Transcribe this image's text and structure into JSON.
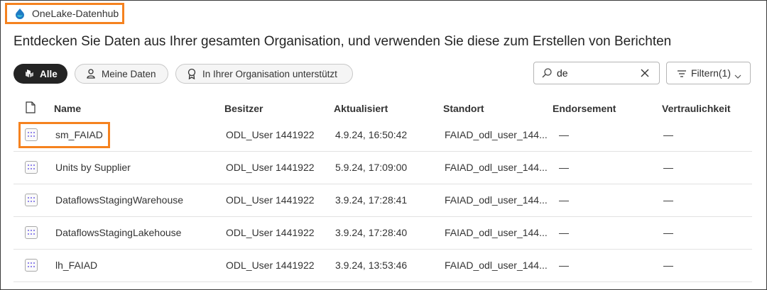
{
  "breadcrumb": {
    "label": "OneLake-Datenhub",
    "icon": "onelake-icon"
  },
  "headline": "Entdecken Sie Daten aus Ihrer gesamten Organisation, und verwenden Sie diese zum Erstellen von Berichten",
  "filters": {
    "all": "Alle",
    "mine": "Meine Daten",
    "endorsed": "In Ihrer Organisation unterstützt"
  },
  "search": {
    "value": "de"
  },
  "filter_button": {
    "label": "Filtern(1)"
  },
  "columns": {
    "name": "Name",
    "owner": "Besitzer",
    "updated": "Aktualisiert",
    "location": "Standort",
    "endorsement": "Endorsement",
    "sensitivity": "Vertraulichkeit"
  },
  "rows": [
    {
      "name": "sm_FAIAD",
      "owner": "ODL_User 1441922",
      "updated": "4.9.24, 16:50:42",
      "location": "FAIAD_odl_user_144...",
      "endorsement": "—",
      "sensitivity": "—"
    },
    {
      "name": "Units by Supplier",
      "owner": "ODL_User 1441922",
      "updated": "5.9.24, 17:09:00",
      "location": "FAIAD_odl_user_144...",
      "endorsement": "—",
      "sensitivity": "—"
    },
    {
      "name": "DataflowsStagingWarehouse",
      "owner": "ODL_User 1441922",
      "updated": "3.9.24, 17:28:41",
      "location": "FAIAD_odl_user_144...",
      "endorsement": "—",
      "sensitivity": "—"
    },
    {
      "name": "DataflowsStagingLakehouse",
      "owner": "ODL_User 1441922",
      "updated": "3.9.24, 17:28:40",
      "location": "FAIAD_odl_user_144...",
      "endorsement": "—",
      "sensitivity": "—"
    },
    {
      "name": "lh_FAIAD",
      "owner": "ODL_User 1441922",
      "updated": "3.9.24, 13:53:46",
      "location": "FAIAD_odl_user_144...",
      "endorsement": "—",
      "sensitivity": "—"
    }
  ],
  "colors": {
    "highlight": "#f5821f",
    "accent": "#7160e8",
    "active_pill": "#242424"
  }
}
